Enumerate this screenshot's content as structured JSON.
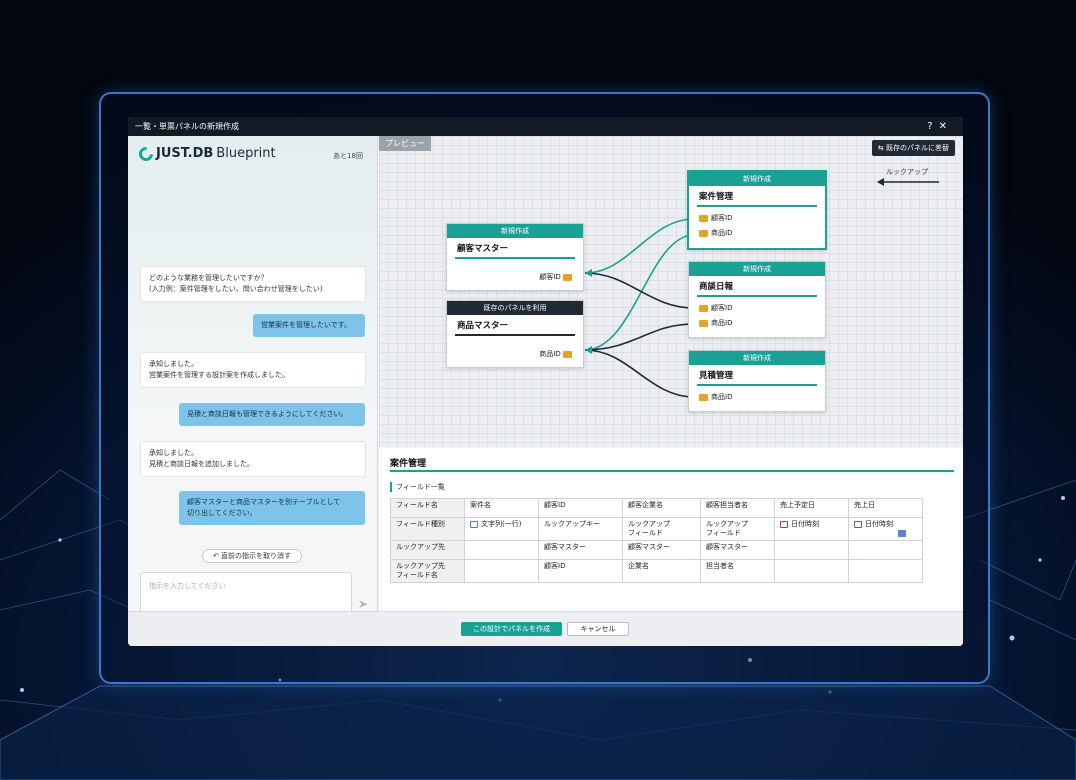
{
  "window": {
    "title": "一覧・単票パネルの新規作成",
    "help": "?",
    "close": "✕"
  },
  "brand": {
    "logo": "JUST.DB",
    "sub": "Blueprint",
    "remaining": "あと18回"
  },
  "chat": [
    {
      "who": "bot",
      "text": "どのような業務を管理したいですか？\n(入力例：案件管理をしたい、問い合わせ管理をしたい)"
    },
    {
      "who": "user",
      "text": "営業案件を管理したいです。"
    },
    {
      "who": "bot",
      "text": "承知しました。\n営業案件を管理する設計案を作成しました。"
    },
    {
      "who": "user",
      "text": "見積と商談日報も管理できるようにしてください。"
    },
    {
      "who": "bot",
      "text": "承知しました。\n見積と商談日報を追加しました。"
    },
    {
      "who": "user",
      "text": "顧客マスターと商品マスターを別テーブルとして\n切り出してください。"
    }
  ],
  "undo_label": "直前の指示を取り消す",
  "input_placeholder": "指示を入力してください",
  "preview": {
    "tab": "プレビュー",
    "swap_label": "既存のパネルに差替",
    "lookup_label": "ルックアップ"
  },
  "cards": {
    "customer": {
      "header": "新規作成",
      "title": "顧客マスター",
      "field": "顧客ID"
    },
    "product": {
      "header": "既存のパネルを利用",
      "title": "商品マスター",
      "field": "商品ID"
    },
    "deal": {
      "header": "新規作成",
      "title": "案件管理",
      "fields": [
        "顧客ID",
        "商品ID"
      ]
    },
    "report": {
      "header": "新規作成",
      "title": "商談日報",
      "fields": [
        "顧客ID",
        "商品ID"
      ]
    },
    "quote": {
      "header": "新規作成",
      "title": "見積管理",
      "fields": [
        "商品ID"
      ]
    }
  },
  "detail": {
    "title": "案件管理",
    "list_label": "フィールド一覧",
    "rows": [
      [
        "フィールド名",
        "案件名",
        "顧客ID",
        "顧客企業名",
        "顧客担当者名",
        "売上予定日",
        "売上日"
      ],
      [
        "フィールド種別",
        "文字列(一行)",
        "ルックアップキー",
        "ルックアップ\nフィールド",
        "ルックアップ\nフィールド",
        "日付時刻",
        "日付時刻"
      ],
      [
        "ルックアップ先",
        "",
        "顧客マスター",
        "顧客マスター",
        "顧客マスター",
        "",
        ""
      ],
      [
        "ルックアップ先\nフィールド名",
        "",
        "顧客ID",
        "企業名",
        "担当者名",
        "",
        ""
      ]
    ]
  },
  "footer": {
    "ok": "この設計でパネルを作成",
    "cancel": "キャンセル"
  }
}
